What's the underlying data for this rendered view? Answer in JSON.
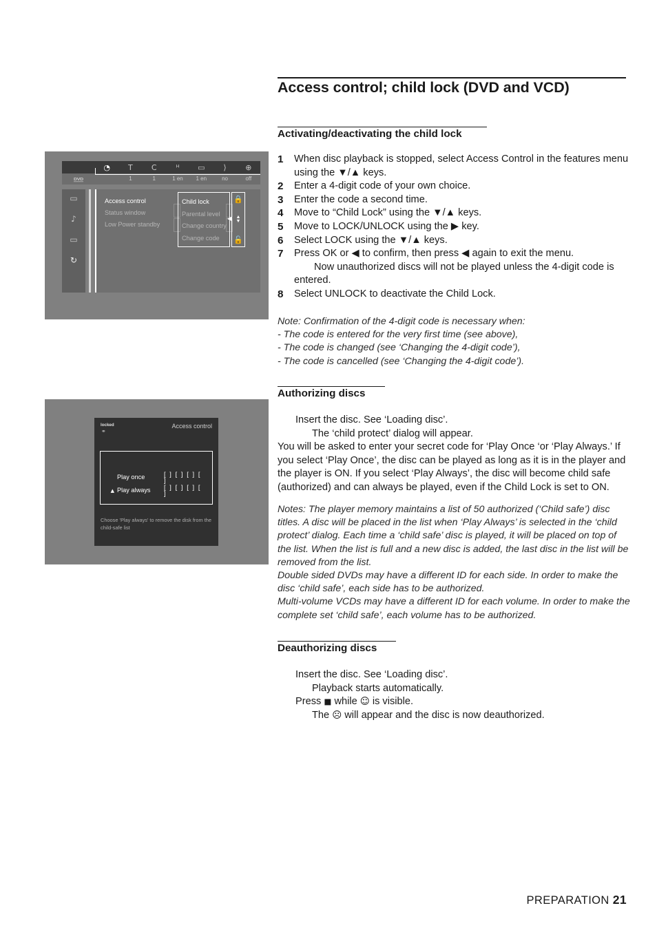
{
  "page": {
    "title": "Access control; child lock (DVD and VCD)",
    "footer_section": "PREPARATION",
    "footer_page": "21"
  },
  "sections": {
    "activating": {
      "heading": "Activating/deactivating the child lock",
      "steps": [
        {
          "num": "1",
          "text": "When disc playback is stopped, select Access Control in the features menu using the ▼/▲ keys."
        },
        {
          "num": "2",
          "text": "Enter a 4-digit code of your own choice."
        },
        {
          "num": "3",
          "text": "Enter the code a second time."
        },
        {
          "num": "4",
          "text": "Move to “Child Lock” using the ▼/▲ keys."
        },
        {
          "num": "5",
          "text": "Move to LOCK/UNLOCK using the ▶ key."
        },
        {
          "num": "6",
          "text": "Select LOCK using the ▼/▲ keys."
        },
        {
          "num": "7",
          "text": "Press OK or ◀ to confirm, then press ◀ again to exit the menu.",
          "sub": "Now unauthorized discs will not be played unless the 4-digit code is entered."
        },
        {
          "num": "8",
          "text": "Select UNLOCK to deactivate the Child Lock."
        }
      ],
      "note_lines": [
        "Note: Confirmation of the 4-digit code is necessary when:",
        "- The code is entered for the very first time (see above),",
        "- The code is changed (see ‘Changing the 4-digit code’),",
        "- The code is cancelled (see ‘Changing the 4-digit code’)."
      ]
    },
    "authorizing": {
      "heading": "Authorizing discs",
      "intro_line_1": "Insert the disc. See ‘Loading disc’.",
      "intro_line_2": "The ‘child protect’ dialog will appear.",
      "paragraph": "You will be asked to enter your secret code for ‘Play Once ‘or ‘Play Always.’ If you select ‘Play Once’, the disc can be played as long as it is in the player and the player is ON. If you select ‘Play Always’, the disc will become child safe (authorized) and can always be played, even if the Child Lock is set to ON.",
      "notes": [
        "Notes: The player memory maintains a list of 50 authorized (‘Child safe’) disc titles. A disc will be placed in the list when ‘Play Always’ is selected in the ‘child protect’ dialog. Each time a ‘child safe’ disc is played, it will be placed on top of the list. When the list is full and a new disc is added, the last disc in the list will be removed from the list.",
        "Double sided DVDs may have a different ID for each side. In order to make the disc ‘child safe’, each side has to be authorized.",
        "Multi-volume VCDs may have a different ID for each volume. In order to make the complete set ‘child safe’, each volume has to be authorized."
      ]
    },
    "deauthorizing": {
      "heading": "Deauthorizing discs",
      "line_1": "Insert the disc. See ‘Loading disc’.",
      "line_2": "Playback starts automatically.",
      "line_3_pre": "Press ",
      "line_3_icon": "■",
      "line_3_mid": " while ",
      "line_3_icon2": "☺",
      "line_3_post": " is visible.",
      "line_4_pre": "The ",
      "line_4_icon": "☹",
      "line_4_post": " will appear and the disc is now deauthorized."
    }
  },
  "screenshot_menu": {
    "toolbar": {
      "dvd_logo": "DVD",
      "cells": [
        {
          "icon": "disc-cursor-icon",
          "glyph": "◔",
          "value": ""
        },
        {
          "icon": "title-icon",
          "glyph": "T",
          "value": "1"
        },
        {
          "icon": "chapter-icon",
          "glyph": "C",
          "value": "1"
        },
        {
          "icon": "audio-icon",
          "glyph": "ᴴ",
          "value": "1 en"
        },
        {
          "icon": "subtitle-icon",
          "glyph": "▭",
          "value": "1 en"
        },
        {
          "icon": "angle-icon",
          "glyph": "⟩",
          "value": "no"
        },
        {
          "icon": "zoom-icon",
          "glyph": "⊕",
          "value": "off"
        }
      ]
    },
    "rail_icons": [
      {
        "name": "picture-settings-icon",
        "glyph": "▭"
      },
      {
        "name": "sound-settings-icon",
        "glyph": "♪"
      },
      {
        "name": "language-settings-icon",
        "glyph": "▭"
      },
      {
        "name": "features-settings-icon",
        "glyph": "↻"
      }
    ],
    "menu_items": [
      {
        "label": "Access control",
        "selected": true
      },
      {
        "label": "Status window",
        "selected": false
      },
      {
        "label": "Low Power standby",
        "selected": false
      }
    ],
    "submenu_items": [
      {
        "label": "Child lock",
        "selected": true
      },
      {
        "label": "Parental level",
        "selected": false
      },
      {
        "label": "Change country",
        "selected": false
      },
      {
        "label": "Change code",
        "selected": false
      }
    ],
    "value_icons": [
      {
        "name": "lock-closed-icon",
        "glyph": "⚿"
      },
      {
        "name": "lock-open-icon",
        "glyph": "⚿"
      }
    ]
  },
  "screenshot_dialog": {
    "status_label": "locked",
    "title": "Access control",
    "options": [
      {
        "marker": "",
        "label": "Play once",
        "code": "[ ] [ ] [ ] [ ]"
      },
      {
        "marker": "▲",
        "label": "Play always",
        "code": "[ ] [ ] [ ] [ ]"
      }
    ],
    "hint": "Choose 'Play always' to remove the disk from the child-safe list"
  },
  "colors": {
    "panel_bg": "#808080",
    "osd_dark": "#303030",
    "osd_mid": "#707070",
    "text": "#1a1a1a"
  }
}
